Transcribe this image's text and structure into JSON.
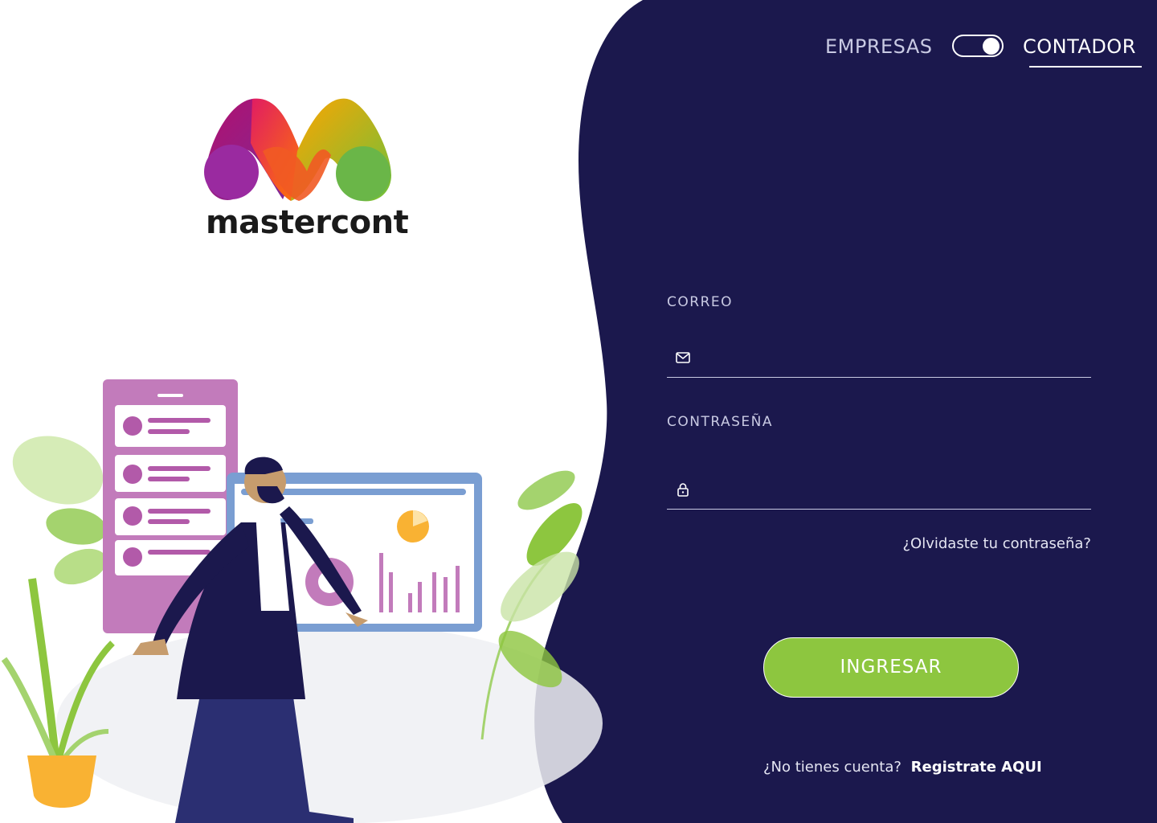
{
  "brand": {
    "name": "mastercont"
  },
  "mode_switch": {
    "left_label": "EMPRESAS",
    "right_label": "CONTADOR",
    "selected": "CONTADOR"
  },
  "form": {
    "email": {
      "label": "CORREO",
      "value": "",
      "placeholder": ""
    },
    "password": {
      "label": "CONTRASEÑA",
      "value": "",
      "placeholder": ""
    },
    "forgot_link": "¿Olvidaste tu contraseña?",
    "submit_label": "INGRESAR",
    "register_prompt": "¿No tienes cuenta?",
    "register_link": "Registrate AQUI"
  },
  "icons": {
    "email": "mail-icon",
    "password": "lock-icon"
  },
  "colors": {
    "panel": "#1b184d",
    "accent": "#8dc63f",
    "muted_text": "#c9cae3"
  }
}
